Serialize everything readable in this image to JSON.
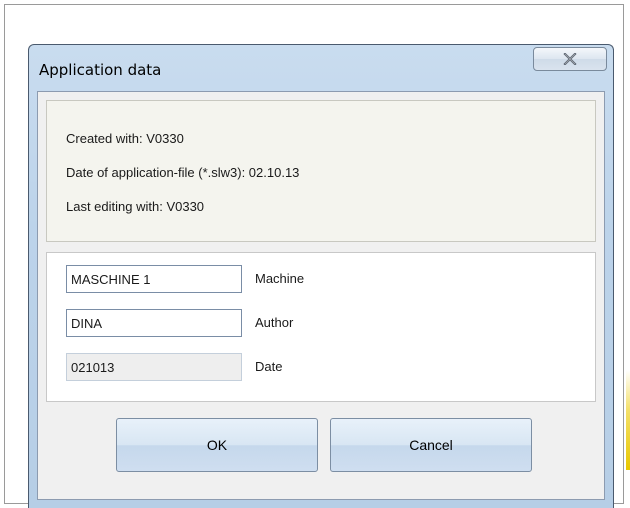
{
  "window": {
    "title": "Application data",
    "close_icon": "close-x-icon"
  },
  "info": {
    "created_with": "Created with:  V0330",
    "date_of_file": "Date of application-file (*.slw3): 02.10.13",
    "last_editing": "Last editing with:  V0330"
  },
  "fields": [
    {
      "value": "MASCHINE 1",
      "label": "Machine",
      "editable": true
    },
    {
      "value": "DINA",
      "label": "Author",
      "editable": true
    },
    {
      "value": "021013",
      "label": "Date",
      "editable": false
    }
  ],
  "buttons": {
    "ok": "OK",
    "cancel": "Cancel"
  },
  "colors": {
    "frame": "#b6cee6",
    "client": "#f0f0f0",
    "info_panel": "#f4f4ee"
  }
}
